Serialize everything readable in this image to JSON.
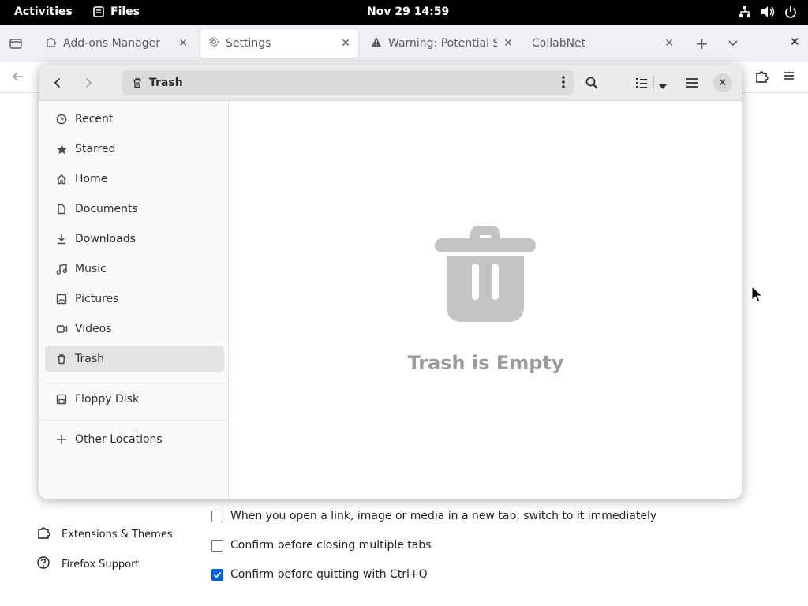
{
  "topbar": {
    "activities": "Activities",
    "app_name": "Files",
    "clock": "Nov 29  14:59"
  },
  "firefox": {
    "tabs": [
      {
        "label": "Add-ons Manager",
        "icon": "puzzle-icon"
      },
      {
        "label": "Settings",
        "icon": "gear-icon"
      },
      {
        "label": "Warning: Potential Sec",
        "icon": "warning-icon"
      },
      {
        "label": "CollabNet",
        "icon": ""
      }
    ],
    "sidebar_links": [
      {
        "label": "Extensions & Themes",
        "icon": "puzzle-icon"
      },
      {
        "label": "Firefox Support",
        "icon": "help-icon"
      }
    ],
    "checkboxes": [
      {
        "label": "When you open a link, image or media in a new tab, switch to it immediately",
        "checked": false
      },
      {
        "label": "Confirm before closing multiple tabs",
        "checked": false
      },
      {
        "label": "Confirm before quitting with Ctrl+Q",
        "checked": true
      }
    ],
    "accent": "#0061e0"
  },
  "files": {
    "path": "Trash",
    "sidebar": [
      {
        "label": "Recent",
        "icon": "clock-icon"
      },
      {
        "label": "Starred",
        "icon": "star-icon"
      },
      {
        "label": "Home",
        "icon": "home-icon"
      },
      {
        "label": "Documents",
        "icon": "document-icon"
      },
      {
        "label": "Downloads",
        "icon": "download-icon"
      },
      {
        "label": "Music",
        "icon": "music-icon"
      },
      {
        "label": "Pictures",
        "icon": "picture-icon"
      },
      {
        "label": "Videos",
        "icon": "video-icon"
      },
      {
        "label": "Trash",
        "icon": "trash-icon",
        "selected": true
      }
    ],
    "devices": [
      {
        "label": "Floppy Disk",
        "icon": "floppy-icon"
      }
    ],
    "other": {
      "label": "Other Locations",
      "icon": "plus-icon"
    },
    "empty_message": "Trash is Empty"
  }
}
